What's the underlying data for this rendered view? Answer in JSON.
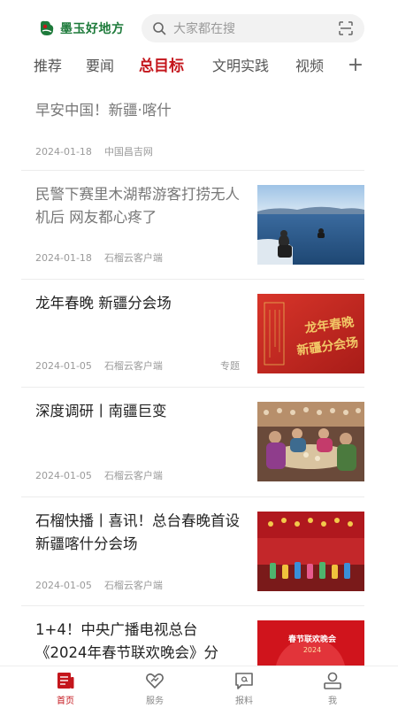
{
  "app": {
    "name": "墨玉好地方",
    "brand_color": "#1d7a3a",
    "accent_color": "#c4161c"
  },
  "search": {
    "placeholder": "大家都在搜"
  },
  "tabs": [
    {
      "label": "推荐",
      "active": false
    },
    {
      "label": "要闻",
      "active": false
    },
    {
      "label": "总目标",
      "active": true
    },
    {
      "label": "文明实践",
      "active": false
    },
    {
      "label": "视频",
      "active": false
    }
  ],
  "feed": [
    {
      "title": "早安中国！新疆·喀什",
      "date": "2024-01-18",
      "source": "中国昌吉网",
      "tag": "",
      "read": true,
      "thumbnail": false
    },
    {
      "title": "民警下赛里木湖帮游客打捞无人机后 网友都心疼了",
      "date": "2024-01-18",
      "source": "石榴云客户端",
      "tag": "",
      "read": true,
      "thumbnail": "lake-rescue-photo"
    },
    {
      "title": "龙年春晚 新疆分会场",
      "date": "2024-01-05",
      "source": "石榴云客户端",
      "tag": "专题",
      "read": false,
      "thumbnail": "gala-poster",
      "thumbnail_text": [
        "龙年春晚",
        "新疆分会场"
      ]
    },
    {
      "title": "深度调研丨南疆巨变",
      "date": "2024-01-05",
      "source": "石榴云客户端",
      "tag": "",
      "read": false,
      "thumbnail": "village-gathering-photo"
    },
    {
      "title": "石榴快播丨喜讯！总台春晚首设新疆喀什分会场",
      "date": "2024-01-05",
      "source": "石榴云客户端",
      "tag": "",
      "read": false,
      "thumbnail": "stage-performance-photo"
    },
    {
      "title": "1+4！中央广播电视总台《2024年春节联欢晚会》分",
      "date": "",
      "source": "",
      "tag": "",
      "read": false,
      "thumbnail": "spring-gala-poster",
      "thumbnail_text": [
        "春节联欢晚会",
        "2024"
      ]
    }
  ],
  "bottom_nav": [
    {
      "label": "首页",
      "icon": "news-icon",
      "active": true
    },
    {
      "label": "服务",
      "icon": "service-heart-icon",
      "active": false
    },
    {
      "label": "报料",
      "icon": "report-icon",
      "active": false
    },
    {
      "label": "我",
      "icon": "profile-icon",
      "active": false
    }
  ]
}
